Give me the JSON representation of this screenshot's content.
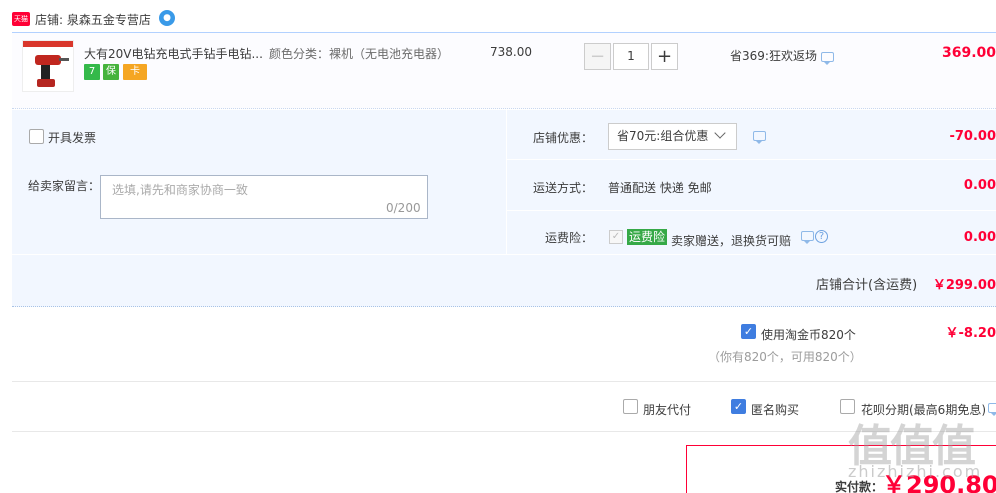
{
  "shop": {
    "logo_text": "天猫",
    "name": "店铺: 泉森五金专营店",
    "ww_icon": "chat-bubble-icon"
  },
  "item": {
    "title": "大有20V电钻充电式手钻手电钻...",
    "sku": "颜色分类：裸机（无电池充电器）",
    "badges": [
      "7",
      "保",
      "卡"
    ],
    "unit_price": "738.00",
    "quantity": "1",
    "minus_label": "−",
    "plus_label": "+",
    "promo": "省369:狂欢返场",
    "subtotal": "369.00"
  },
  "options": {
    "invoice_label": "开具发票",
    "memo_label": "给卖家留言：",
    "memo_placeholder": "选填,请先和商家协商一致",
    "memo_count": "0/200",
    "shop_discount_label": "店铺优惠：",
    "shop_discount_value": "省70元:组合优惠",
    "shop_discount_amount": "-70.00",
    "shipping_label": "运送方式：",
    "shipping_value": "普通配送 快递 免邮",
    "shipping_amount": "0.00",
    "insurance_label": "运费险：",
    "insurance_tag": "运费险",
    "insurance_desc": "卖家赠送，退换货可赔",
    "insurance_amount": "0.00"
  },
  "shop_total": {
    "label": "店铺合计(含运费)",
    "value": "￥299.00"
  },
  "coins": {
    "label": "使用淘金币820个",
    "sub": "（你有820个，可用820个）",
    "value": "￥-8.20"
  },
  "pay_options": {
    "friend_pay": "朋友代付",
    "anonymous": "匿名购买",
    "huabei": "花呗分期(最高6期免息)"
  },
  "final": {
    "label": "实付款：",
    "value": "￥290.80"
  },
  "watermark": {
    "glyphs": "值值值",
    "site": "zhizhizhi.com"
  },
  "colors": {
    "accent_red": "#ff0036",
    "panel_blue": "#f2f7ff",
    "check_blue": "#3f7de0",
    "tag_green": "#36a947"
  }
}
